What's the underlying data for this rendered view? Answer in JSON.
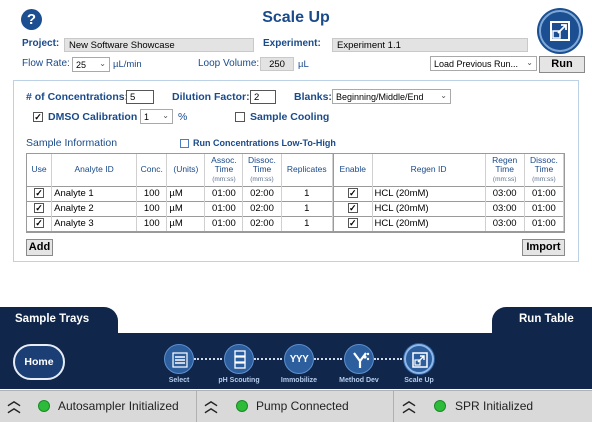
{
  "header": {
    "title": "Scale Up",
    "help_label": "?",
    "project_label": "Project:",
    "project_value": "New Software Showcase",
    "experiment_label": "Experiment:",
    "experiment_value": "Experiment 1.1",
    "flow_rate_label": "Flow Rate:",
    "flow_rate_value": "25",
    "flow_rate_unit": "µL/min",
    "loop_volume_label": "Loop Volume:",
    "loop_volume_value": "250",
    "loop_volume_unit": "µL",
    "load_previous_label": "Load Previous Run...",
    "run_label": "Run"
  },
  "settings": {
    "num_conc_label": "# of Concentrations:",
    "num_conc_value": "5",
    "dilution_label": "Dilution Factor:",
    "dilution_value": "2",
    "blanks_label": "Blanks:",
    "blanks_value": "Beginning/Middle/End",
    "dmso_label": "DMSO Calibration",
    "dmso_checked": true,
    "dmso_value": "1",
    "dmso_unit": "%",
    "sample_cooling_label": "Sample Cooling",
    "sample_cooling_checked": false,
    "sample_info_title": "Sample Information",
    "low_to_high_label": "Run Concentrations Low-To-High",
    "low_to_high_checked": false
  },
  "table": {
    "headers": {
      "use": "Use",
      "analyte_id": "Analyte ID",
      "conc": "Conc.",
      "units": "(Units)",
      "assoc_time": "Assoc. Time",
      "assoc_unit": "(mm:ss)",
      "dissoc_time": "Dissoc. Time",
      "dissoc_unit": "(mm:ss)",
      "replicates": "Replicates",
      "enable": "Enable",
      "regen_id": "Regen ID",
      "regen_time": "Regen Time",
      "regen_unit": "(mm:ss)",
      "regen_dissoc_time": "Dissoc. Time",
      "regen_dissoc_unit": "(mm:ss)"
    },
    "rows": [
      {
        "use": true,
        "analyte": "Analyte 1",
        "conc": "100",
        "units": "µM",
        "assoc": "01:00",
        "dissoc": "02:00",
        "replicates": "1",
        "enable": true,
        "regen_id": "HCL (20mM)",
        "regen_time": "03:00",
        "regen_dissoc": "01:00"
      },
      {
        "use": true,
        "analyte": "Analyte 2",
        "conc": "100",
        "units": "µM",
        "assoc": "01:00",
        "dissoc": "02:00",
        "replicates": "1",
        "enable": true,
        "regen_id": "HCL (20mM)",
        "regen_time": "03:00",
        "regen_dissoc": "01:00"
      },
      {
        "use": true,
        "analyte": "Analyte 3",
        "conc": "100",
        "units": "µM",
        "assoc": "01:00",
        "dissoc": "02:00",
        "replicates": "1",
        "enable": true,
        "regen_id": "HCL (20mM)",
        "regen_time": "03:00",
        "regen_dissoc": "01:00"
      }
    ],
    "add_label": "Add",
    "import_label": "Import"
  },
  "nav": {
    "sample_trays_label": "Sample Trays",
    "run_table_label": "Run Table",
    "home_label": "Home",
    "steps": [
      {
        "label": "Select",
        "icon": "list-icon",
        "active": false
      },
      {
        "label": "pH Scouting",
        "icon": "stack-icon",
        "active": false
      },
      {
        "label": "Immobilize",
        "icon": "yyy-icon",
        "active": false,
        "glyph": "YYY"
      },
      {
        "label": "Method Dev",
        "icon": "molecule-icon",
        "active": false
      },
      {
        "label": "Scale Up",
        "icon": "scale-up-icon",
        "active": true
      }
    ]
  },
  "status": {
    "items": [
      {
        "label": "Autosampler Initialized",
        "state": "ok"
      },
      {
        "label": "Pump Connected",
        "state": "ok"
      },
      {
        "label": "SPR Initialized",
        "state": "ok"
      }
    ],
    "ok_color": "#2dbb3a"
  },
  "colors": {
    "accent": "#1a4a8a",
    "nav_bg": "#10264a",
    "step_bg": "#2d5f9f"
  }
}
